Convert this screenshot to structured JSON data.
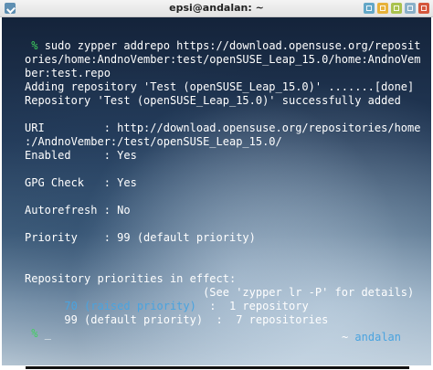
{
  "window": {
    "title": "epsi@andalan: ~"
  },
  "terminal": {
    "lines": [
      {
        "prefix": " % ",
        "text": "sudo zypper addrepo https://download.opensuse.org/reposit"
      },
      {
        "text": "ories/home:AndnoVember:test/openSUSE_Leap_15.0/home:AndnoVem"
      },
      {
        "text": "ber:test.repo"
      },
      {
        "text": "Adding repository 'Test (openSUSE_Leap_15.0)' .......[done]"
      },
      {
        "text": "Repository 'Test (openSUSE_Leap_15.0)' successfully added"
      },
      {
        "text": ""
      },
      {
        "text": "URI         : http://download.opensuse.org/repositories/home"
      },
      {
        "text": ":/AndnoVember:/test/openSUSE_Leap_15.0/"
      },
      {
        "text": "Enabled     : Yes"
      },
      {
        "text": ""
      },
      {
        "text": "GPG Check   : Yes"
      },
      {
        "text": ""
      },
      {
        "text": "Autorefresh : No"
      },
      {
        "text": ""
      },
      {
        "text": "Priority    : 99 (default priority)"
      },
      {
        "text": ""
      },
      {
        "text": ""
      },
      {
        "text": "Repository priorities in effect:"
      },
      {
        "text": "                           (See 'zypper lr -P' for details)"
      },
      {
        "highlight": "      70 (raised priority)",
        "text": "  :  1 repository"
      },
      {
        "text": "      99 (default priority)  :  7 repositories"
      },
      {
        "prefix": " % ",
        "text": "_"
      }
    ],
    "right_prompt": {
      "tilde": "~",
      "host": "andalan"
    }
  }
}
